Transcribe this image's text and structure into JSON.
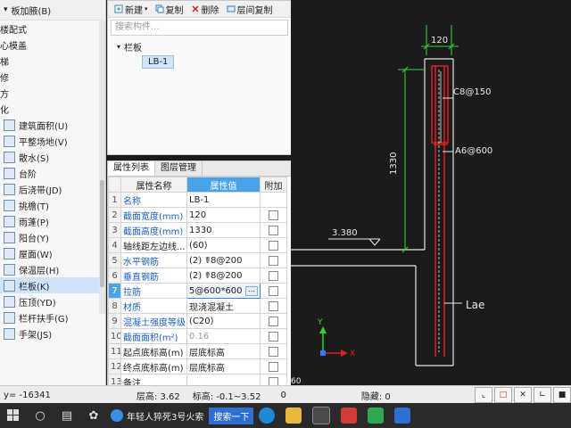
{
  "left_tree": {
    "header": "板加腋(B)",
    "items": [
      {
        "label": "楼配式"
      },
      {
        "label": "心模盖"
      },
      {
        "label": "梯"
      },
      {
        "label": "修"
      },
      {
        "label": "方"
      },
      {
        "label": "化"
      },
      {
        "label": "建筑面积(U)"
      },
      {
        "label": "平整场地(V)"
      },
      {
        "label": "散水(S)"
      },
      {
        "label": "台阶"
      },
      {
        "label": "后浇带(JD)"
      },
      {
        "label": "挑檐(T)"
      },
      {
        "label": "雨蓬(P)"
      },
      {
        "label": "阳台(Y)"
      },
      {
        "label": "屋面(W)"
      },
      {
        "label": "保温层(H)"
      },
      {
        "label": "栏板(K)"
      },
      {
        "label": "压顶(YD)"
      },
      {
        "label": "栏杆扶手(G)"
      },
      {
        "label": "手架(JS)"
      }
    ]
  },
  "component_panel": {
    "toolbar": {
      "new": "新建",
      "copy": "复制",
      "delete": "删除",
      "floor_copy": "层间复制"
    },
    "search_placeholder": "搜索构件...",
    "group": "栏板",
    "item": "LB-1"
  },
  "property_panel": {
    "tabs": [
      "属性列表",
      "图层管理"
    ],
    "headers": {
      "name": "属性名称",
      "value": "属性值",
      "extra": "附加"
    },
    "rows": [
      {
        "num": "1",
        "name": "名称",
        "value": "LB-1"
      },
      {
        "num": "2",
        "name": "截面宽度(mm)",
        "value": "120"
      },
      {
        "num": "3",
        "name": "截面高度(mm)",
        "value": "1330"
      },
      {
        "num": "4",
        "name": "轴线距左边线...",
        "value": "(60)"
      },
      {
        "num": "5",
        "name": "水平钢筋",
        "value": "(2) ☤8@200"
      },
      {
        "num": "6",
        "name": "垂直钢筋",
        "value": "(2) ☤8@200"
      },
      {
        "num": "7",
        "name": "拉筋",
        "value": "5@600*600"
      },
      {
        "num": "8",
        "name": "材质",
        "value": "现浇混凝土"
      },
      {
        "num": "9",
        "name": "混凝土强度等级",
        "value": "(C20)"
      },
      {
        "num": "10",
        "name": "截面面积(m²)",
        "value": "0.16"
      },
      {
        "num": "11",
        "name": "起点底标高(m)",
        "value": "层底标高"
      },
      {
        "num": "12",
        "name": "终点底标高(m)",
        "value": "层底标高"
      },
      {
        "num": "13",
        "name": "备注",
        "value": ""
      }
    ]
  },
  "cad": {
    "dim_width": "120",
    "label_stirrup": "C8@150",
    "label_tie": "A6@600",
    "dim_height": "1330",
    "level": "3.380",
    "lae": "Lae",
    "axis_x": "X",
    "axis_y": "Y",
    "corner_text": "60"
  },
  "status_bar": {
    "coord": "y= -16341",
    "floor_height": "层高: 3.62",
    "elevation": "标高: -0.1~3.52",
    "zero": "0",
    "hidden": "隐藏: 0"
  },
  "taskbar": {
    "news": "年轻人猝死3号火索",
    "search": "搜索一下"
  },
  "colors": {
    "selected_blue": "#4aa3e8",
    "cad_background": "#1b1b1b",
    "cad_green": "#2fd52f",
    "cad_red": "#e02020"
  }
}
